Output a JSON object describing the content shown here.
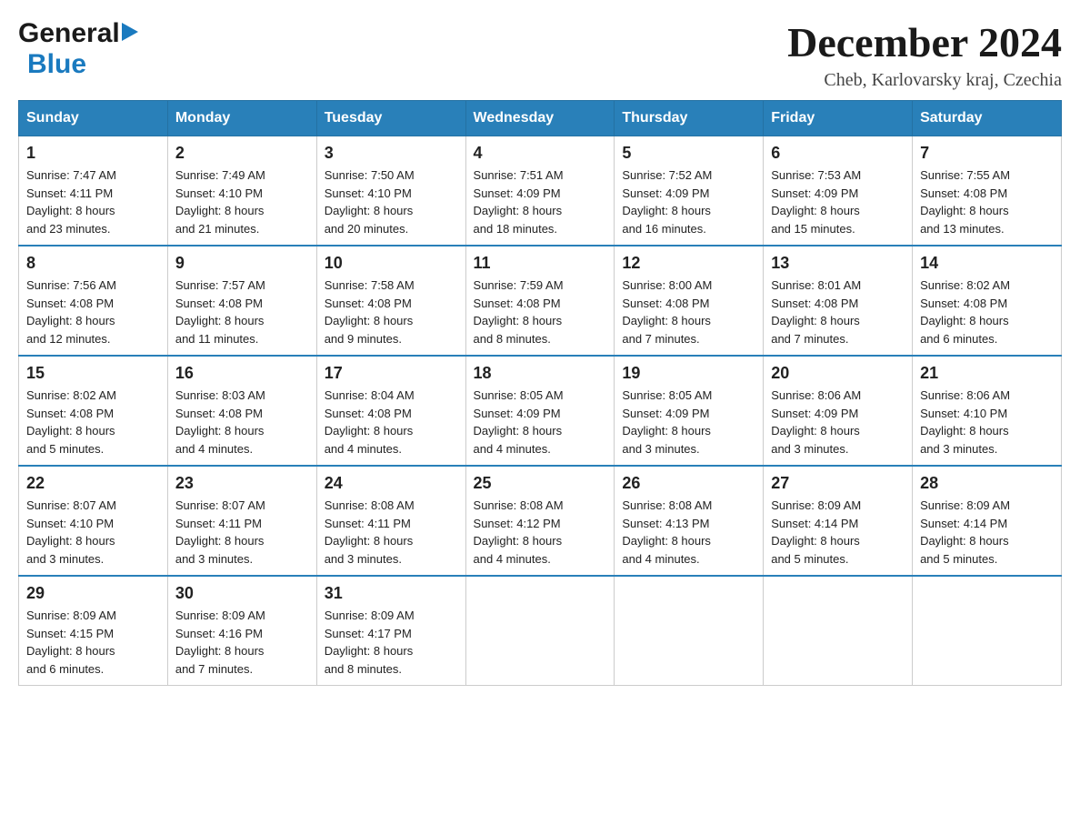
{
  "header": {
    "logo_general": "General",
    "logo_blue": "Blue",
    "title": "December 2024",
    "subtitle": "Cheb, Karlovarsky kraj, Czechia"
  },
  "days_of_week": [
    "Sunday",
    "Monday",
    "Tuesday",
    "Wednesday",
    "Thursday",
    "Friday",
    "Saturday"
  ],
  "weeks": [
    [
      {
        "day": "1",
        "sunrise": "7:47 AM",
        "sunset": "4:11 PM",
        "daylight": "8 hours and 23 minutes."
      },
      {
        "day": "2",
        "sunrise": "7:49 AM",
        "sunset": "4:10 PM",
        "daylight": "8 hours and 21 minutes."
      },
      {
        "day": "3",
        "sunrise": "7:50 AM",
        "sunset": "4:10 PM",
        "daylight": "8 hours and 20 minutes."
      },
      {
        "day": "4",
        "sunrise": "7:51 AM",
        "sunset": "4:09 PM",
        "daylight": "8 hours and 18 minutes."
      },
      {
        "day": "5",
        "sunrise": "7:52 AM",
        "sunset": "4:09 PM",
        "daylight": "8 hours and 16 minutes."
      },
      {
        "day": "6",
        "sunrise": "7:53 AM",
        "sunset": "4:09 PM",
        "daylight": "8 hours and 15 minutes."
      },
      {
        "day": "7",
        "sunrise": "7:55 AM",
        "sunset": "4:08 PM",
        "daylight": "8 hours and 13 minutes."
      }
    ],
    [
      {
        "day": "8",
        "sunrise": "7:56 AM",
        "sunset": "4:08 PM",
        "daylight": "8 hours and 12 minutes."
      },
      {
        "day": "9",
        "sunrise": "7:57 AM",
        "sunset": "4:08 PM",
        "daylight": "8 hours and 11 minutes."
      },
      {
        "day": "10",
        "sunrise": "7:58 AM",
        "sunset": "4:08 PM",
        "daylight": "8 hours and 9 minutes."
      },
      {
        "day": "11",
        "sunrise": "7:59 AM",
        "sunset": "4:08 PM",
        "daylight": "8 hours and 8 minutes."
      },
      {
        "day": "12",
        "sunrise": "8:00 AM",
        "sunset": "4:08 PM",
        "daylight": "8 hours and 7 minutes."
      },
      {
        "day": "13",
        "sunrise": "8:01 AM",
        "sunset": "4:08 PM",
        "daylight": "8 hours and 7 minutes."
      },
      {
        "day": "14",
        "sunrise": "8:02 AM",
        "sunset": "4:08 PM",
        "daylight": "8 hours and 6 minutes."
      }
    ],
    [
      {
        "day": "15",
        "sunrise": "8:02 AM",
        "sunset": "4:08 PM",
        "daylight": "8 hours and 5 minutes."
      },
      {
        "day": "16",
        "sunrise": "8:03 AM",
        "sunset": "4:08 PM",
        "daylight": "8 hours and 4 minutes."
      },
      {
        "day": "17",
        "sunrise": "8:04 AM",
        "sunset": "4:08 PM",
        "daylight": "8 hours and 4 minutes."
      },
      {
        "day": "18",
        "sunrise": "8:05 AM",
        "sunset": "4:09 PM",
        "daylight": "8 hours and 4 minutes."
      },
      {
        "day": "19",
        "sunrise": "8:05 AM",
        "sunset": "4:09 PM",
        "daylight": "8 hours and 3 minutes."
      },
      {
        "day": "20",
        "sunrise": "8:06 AM",
        "sunset": "4:09 PM",
        "daylight": "8 hours and 3 minutes."
      },
      {
        "day": "21",
        "sunrise": "8:06 AM",
        "sunset": "4:10 PM",
        "daylight": "8 hours and 3 minutes."
      }
    ],
    [
      {
        "day": "22",
        "sunrise": "8:07 AM",
        "sunset": "4:10 PM",
        "daylight": "8 hours and 3 minutes."
      },
      {
        "day": "23",
        "sunrise": "8:07 AM",
        "sunset": "4:11 PM",
        "daylight": "8 hours and 3 minutes."
      },
      {
        "day": "24",
        "sunrise": "8:08 AM",
        "sunset": "4:11 PM",
        "daylight": "8 hours and 3 minutes."
      },
      {
        "day": "25",
        "sunrise": "8:08 AM",
        "sunset": "4:12 PM",
        "daylight": "8 hours and 4 minutes."
      },
      {
        "day": "26",
        "sunrise": "8:08 AM",
        "sunset": "4:13 PM",
        "daylight": "8 hours and 4 minutes."
      },
      {
        "day": "27",
        "sunrise": "8:09 AM",
        "sunset": "4:14 PM",
        "daylight": "8 hours and 5 minutes."
      },
      {
        "day": "28",
        "sunrise": "8:09 AM",
        "sunset": "4:14 PM",
        "daylight": "8 hours and 5 minutes."
      }
    ],
    [
      {
        "day": "29",
        "sunrise": "8:09 AM",
        "sunset": "4:15 PM",
        "daylight": "8 hours and 6 minutes."
      },
      {
        "day": "30",
        "sunrise": "8:09 AM",
        "sunset": "4:16 PM",
        "daylight": "8 hours and 7 minutes."
      },
      {
        "day": "31",
        "sunrise": "8:09 AM",
        "sunset": "4:17 PM",
        "daylight": "8 hours and 8 minutes."
      },
      null,
      null,
      null,
      null
    ]
  ],
  "labels": {
    "sunrise": "Sunrise:",
    "sunset": "Sunset:",
    "daylight": "Daylight:"
  }
}
